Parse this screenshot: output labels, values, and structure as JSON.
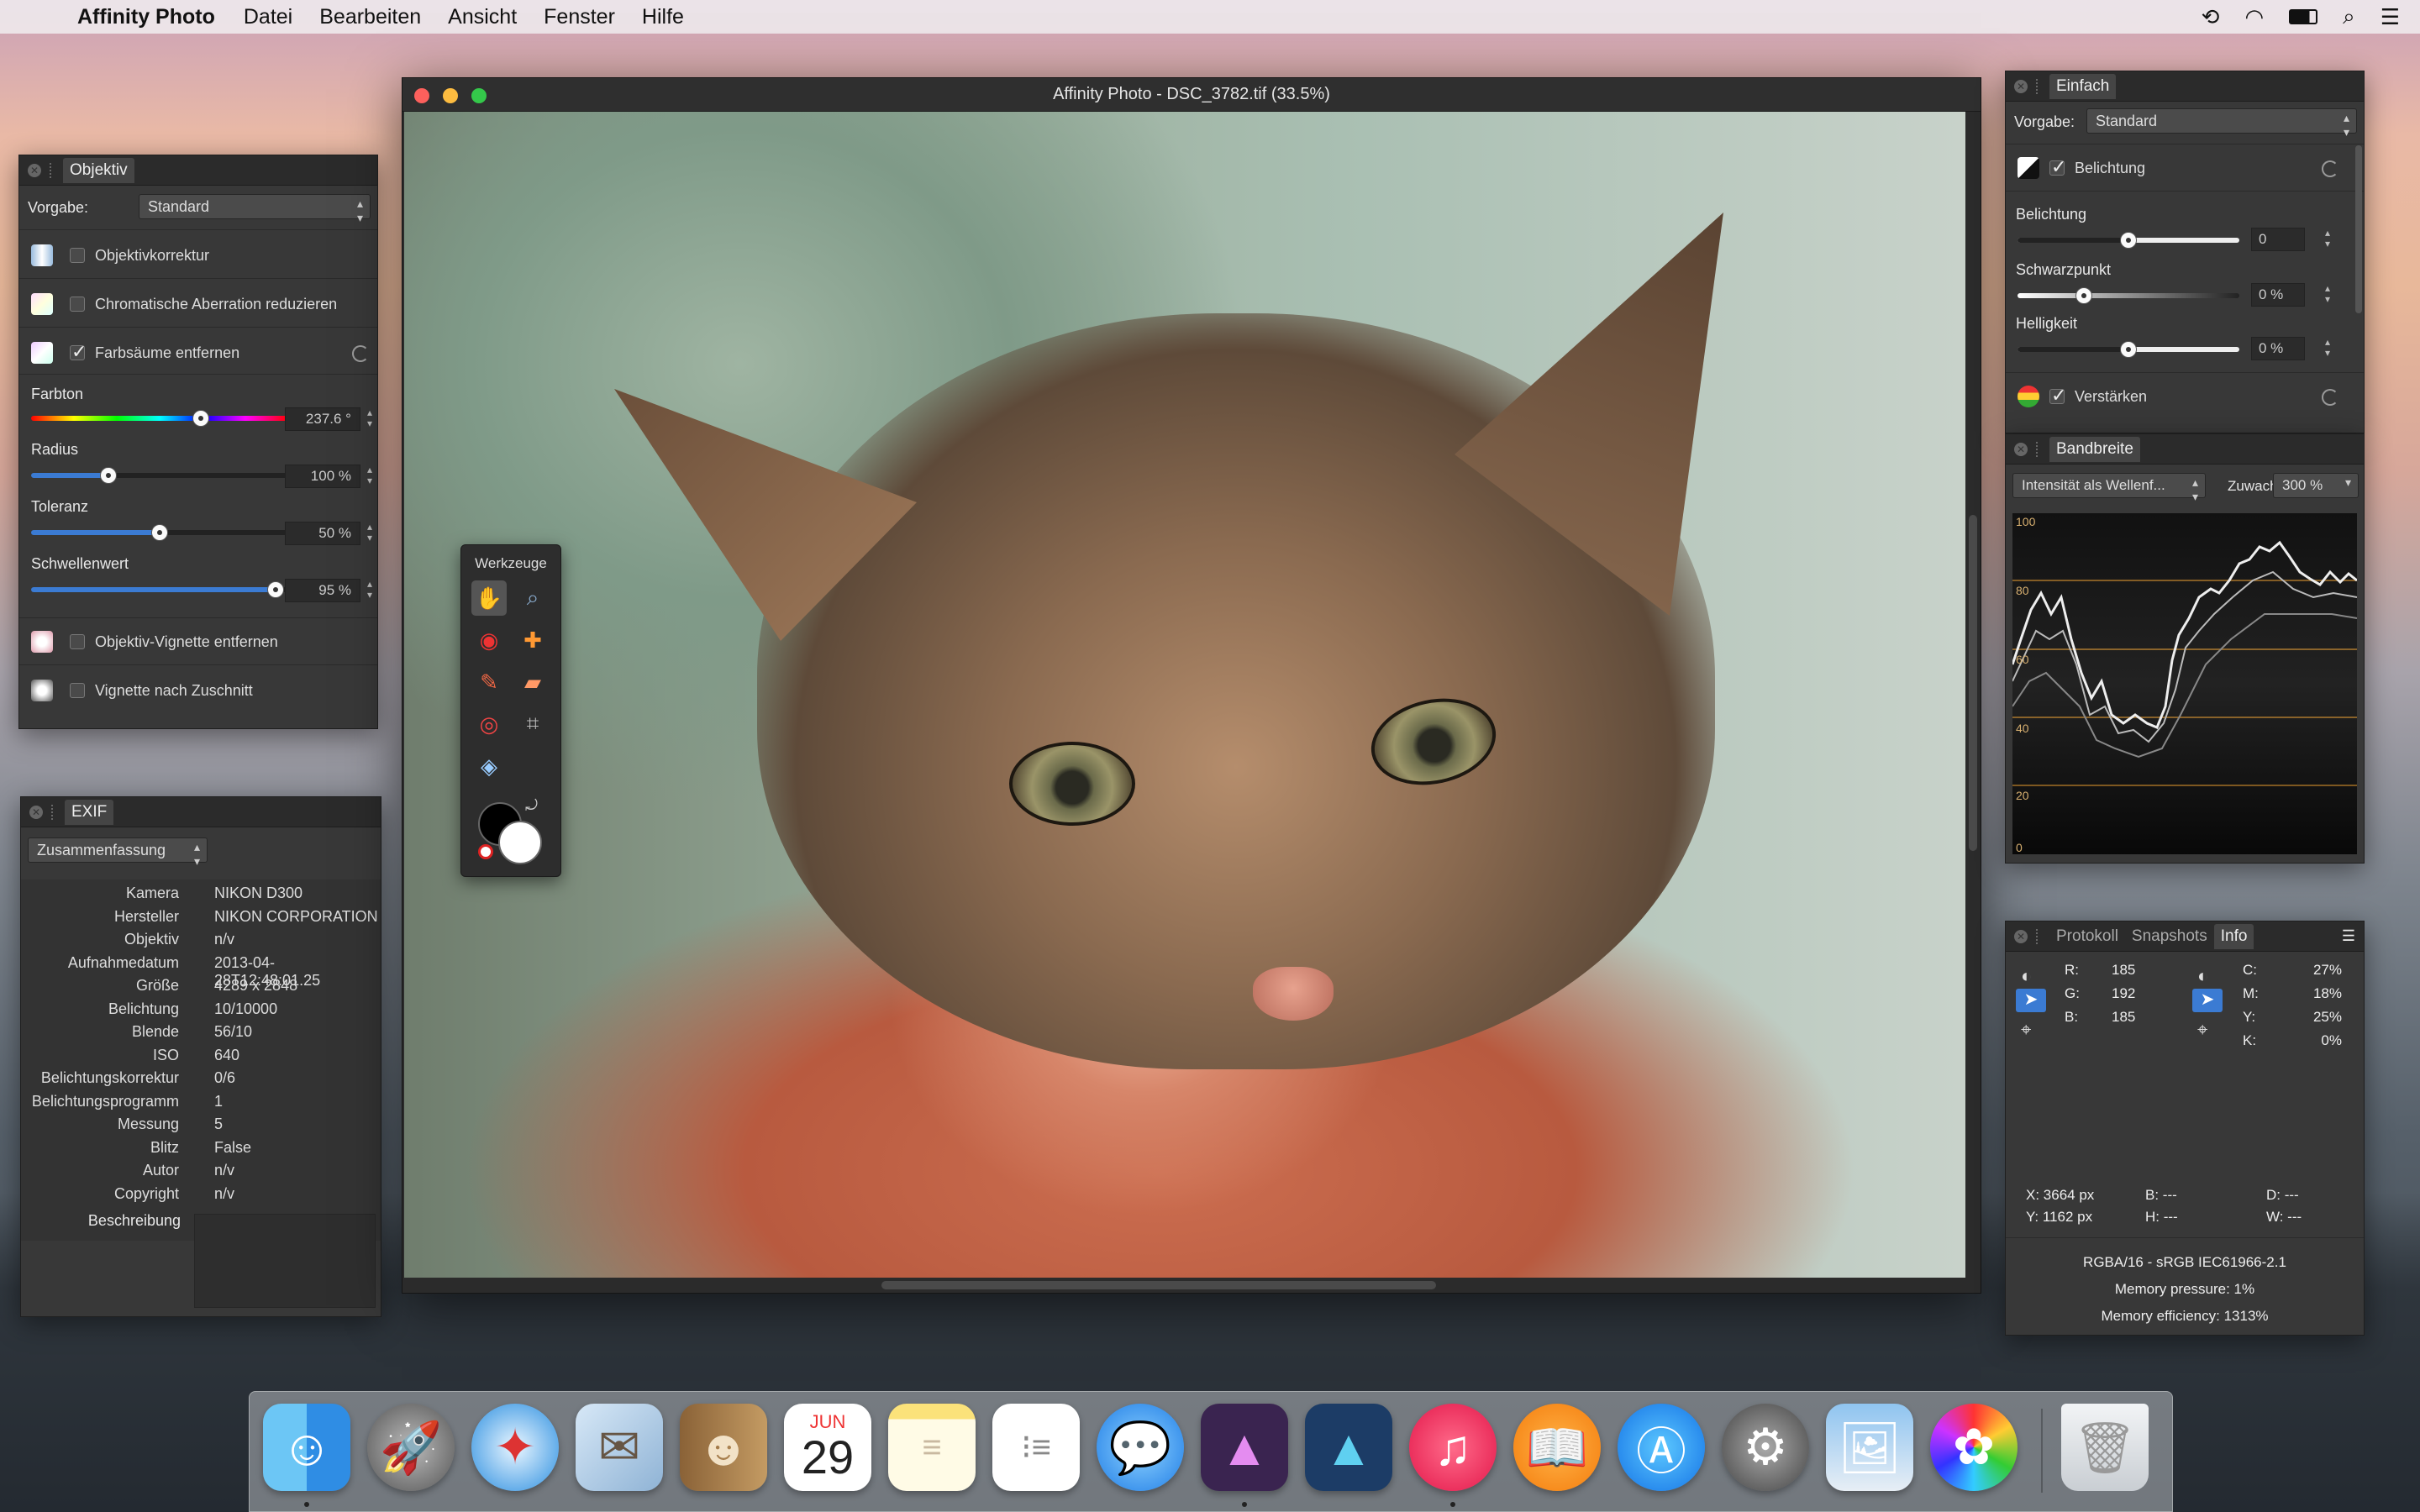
{
  "menubar": {
    "app": "Affinity Photo",
    "items": [
      "Datei",
      "Bearbeiten",
      "Ansicht",
      "Fenster",
      "Hilfe"
    ]
  },
  "window": {
    "title": "Affinity Photo - DSC_3782.tif (33.5%)"
  },
  "objektiv": {
    "tab": "Objektiv",
    "preset_label": "Vorgabe:",
    "preset": "Standard",
    "opt1": "Objektivkorrektur",
    "opt2": "Chromatische Aberration reduzieren",
    "opt3": "Farbsäume entfernen",
    "farbton_label": "Farbton",
    "farbton": "237.6 °",
    "radius_label": "Radius",
    "radius": "100 %",
    "toleranz_label": "Toleranz",
    "toleranz": "50 %",
    "schwellenwert_label": "Schwellenwert",
    "schwellenwert": "95 %",
    "opt4": "Objektiv-Vignette entfernen",
    "opt5": "Vignette nach Zuschnitt",
    "farbton_value": 0.66,
    "radius_value": 0.3,
    "toleranz_value": 0.5,
    "schwellenwert_value": 0.95
  },
  "exif": {
    "tab": "EXIF",
    "mode": "Zusammenfassung",
    "rows": [
      {
        "k": "Kamera",
        "v": "NIKON D300"
      },
      {
        "k": "Hersteller",
        "v": "NIKON CORPORATION"
      },
      {
        "k": "Objektiv",
        "v": "n/v"
      },
      {
        "k": "Aufnahmedatum",
        "v": "2013-04-28T12:48:01.25"
      },
      {
        "k": "Größe",
        "v": "4289 x 2848"
      },
      {
        "k": "Belichtung",
        "v": "10/10000"
      },
      {
        "k": "Blende",
        "v": "56/10"
      },
      {
        "k": "ISO",
        "v": "640"
      },
      {
        "k": "Belichtungskorrektur",
        "v": "0/6"
      },
      {
        "k": "Belichtungsprogramm",
        "v": "1"
      },
      {
        "k": "Messung",
        "v": "5"
      },
      {
        "k": "Blitz",
        "v": "False"
      },
      {
        "k": "Autor",
        "v": "n/v"
      },
      {
        "k": "Copyright",
        "v": "n/v"
      }
    ],
    "desc_label": "Beschreibung"
  },
  "tools": {
    "title": "Werkzeuge"
  },
  "einfach": {
    "tab": "Einfach",
    "preset_label": "Vorgabe:",
    "preset": "Standard",
    "section1": "Belichtung",
    "bel_label": "Belichtung",
    "bel": "0",
    "sp_label": "Schwarzpunkt",
    "sp": "0 %",
    "hell_label": "Helligkeit",
    "hell": "0 %",
    "section2": "Verstärken",
    "bel_value": 0.5,
    "sp_value": 0.3,
    "hell_value": 0.5
  },
  "bandbreite": {
    "tab": "Bandbreite",
    "mode": "Intensität als Wellenf...",
    "zoom_label": "Zuwachs",
    "zoom": "300 %",
    "ticks": [
      "100",
      "80",
      "60",
      "40",
      "20",
      "0"
    ]
  },
  "info": {
    "tabs": [
      "Protokoll",
      "Snapshots",
      "Info"
    ],
    "rgb": [
      {
        "k": "R:",
        "v": "185"
      },
      {
        "k": "G:",
        "v": "192"
      },
      {
        "k": "B:",
        "v": "185"
      }
    ],
    "cmyk": [
      {
        "k": "C:",
        "v": "27%"
      },
      {
        "k": "M:",
        "v": "18%"
      },
      {
        "k": "Y:",
        "v": "25%"
      },
      {
        "k": "K:",
        "v": "0%"
      }
    ],
    "x": "X: 3664 px",
    "y": "Y: 1162 px",
    "b": "B: ---",
    "h": "H: ---",
    "d": "D: ---",
    "w": "W: ---",
    "profile": "RGBA/16 - sRGB IEC61966-2.1",
    "pressure": "Memory pressure: 1%",
    "efficiency": "Memory efficiency: 1313%"
  },
  "dock": {
    "calendar_month": "JUN",
    "calendar_day": "29",
    "icons": [
      "finder-icon",
      "launchpad-icon",
      "safari-icon",
      "mail-icon",
      "contacts-icon",
      "calendar-icon",
      "notes-icon",
      "reminders-icon",
      "messages-icon",
      "affinity-photo-icon",
      "affinity-designer-icon",
      "itunes-icon",
      "ibooks-icon",
      "app-store-icon",
      "system-preferences-icon",
      "preview-icon",
      "photos-icon",
      "trash-icon"
    ]
  }
}
